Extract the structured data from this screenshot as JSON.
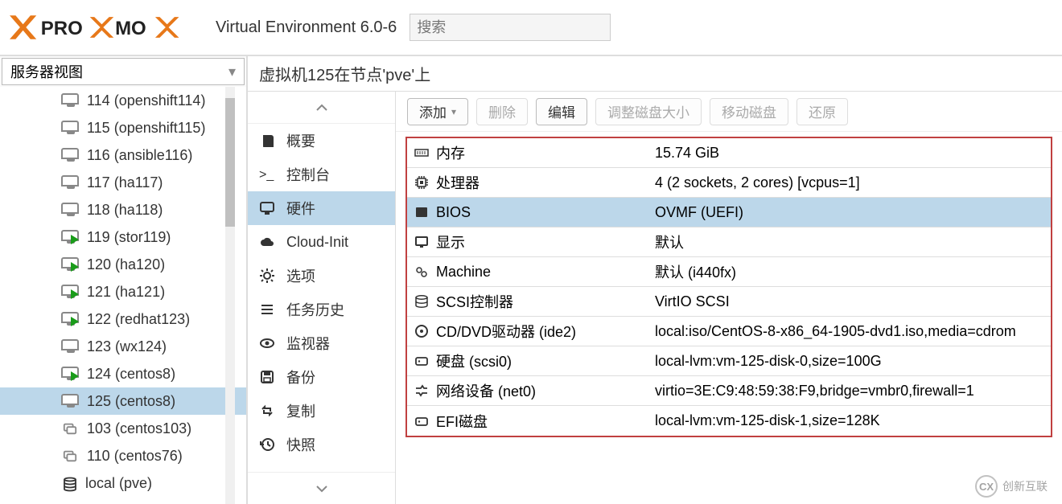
{
  "header": {
    "version_label": "Virtual Environment 6.0-6",
    "search_placeholder": "搜索"
  },
  "tree": {
    "view_label": "服务器视图",
    "items": [
      {
        "label": "114 (openshift114)",
        "type": "vm",
        "running": false
      },
      {
        "label": "115 (openshift115)",
        "type": "vm",
        "running": false
      },
      {
        "label": "116 (ansible116)",
        "type": "vm",
        "running": false
      },
      {
        "label": "117 (ha117)",
        "type": "vm",
        "running": false
      },
      {
        "label": "118 (ha118)",
        "type": "vm",
        "running": false
      },
      {
        "label": "119 (stor119)",
        "type": "vm",
        "running": true
      },
      {
        "label": "120 (ha120)",
        "type": "vm",
        "running": true
      },
      {
        "label": "121 (ha121)",
        "type": "vm",
        "running": true
      },
      {
        "label": "122 (redhat123)",
        "type": "vm",
        "running": true
      },
      {
        "label": "123 (wx124)",
        "type": "vm",
        "running": false
      },
      {
        "label": "124 (centos8)",
        "type": "vm",
        "running": true
      },
      {
        "label": "125 (centos8)",
        "type": "vm",
        "running": false,
        "selected": true
      },
      {
        "label": "103 (centos103)",
        "type": "lxc",
        "running": false
      },
      {
        "label": "110 (centos76)",
        "type": "lxc",
        "running": false
      },
      {
        "label": "local (pve)",
        "type": "storage",
        "running": false
      }
    ]
  },
  "content": {
    "title": "虚拟机125在节点'pve'上"
  },
  "midnav": {
    "items": [
      {
        "label": "概要",
        "icon": "book"
      },
      {
        "label": "控制台",
        "icon": "terminal"
      },
      {
        "label": "硬件",
        "icon": "monitor",
        "selected": true
      },
      {
        "label": "Cloud-Init",
        "icon": "cloud"
      },
      {
        "label": "选项",
        "icon": "gear"
      },
      {
        "label": "任务历史",
        "icon": "list"
      },
      {
        "label": "监视器",
        "icon": "eye"
      },
      {
        "label": "备份",
        "icon": "save"
      },
      {
        "label": "复制",
        "icon": "retweet"
      },
      {
        "label": "快照",
        "icon": "history"
      }
    ]
  },
  "toolbar": {
    "add": "添加",
    "remove": "删除",
    "edit": "编辑",
    "resize": "调整磁盘大小",
    "move": "移动磁盘",
    "revert": "还原"
  },
  "hardware": [
    {
      "icon": "memory",
      "key": "内存",
      "val": "15.74 GiB"
    },
    {
      "icon": "cpu",
      "key": "处理器",
      "val": "4 (2 sockets, 2 cores) [vcpus=1]"
    },
    {
      "icon": "bios",
      "key": "BIOS",
      "val": "OVMF (UEFI)",
      "selected": true
    },
    {
      "icon": "display",
      "key": "显示",
      "val": "默认"
    },
    {
      "icon": "gears",
      "key": "Machine",
      "val": "默认 (i440fx)"
    },
    {
      "icon": "stack",
      "key": "SCSI控制器",
      "val": "VirtIO SCSI"
    },
    {
      "icon": "disc",
      "key": "CD/DVD驱动器 (ide2)",
      "val": "local:iso/CentOS-8-x86_64-1905-dvd1.iso,media=cdrom"
    },
    {
      "icon": "hdd",
      "key": "硬盘 (scsi0)",
      "val": "local-lvm:vm-125-disk-0,size=100G"
    },
    {
      "icon": "net",
      "key": "网络设备 (net0)",
      "val": "virtio=3E:C9:48:59:38:F9,bridge=vmbr0,firewall=1"
    },
    {
      "icon": "hdd",
      "key": "EFI磁盘",
      "val": "local-lvm:vm-125-disk-1,size=128K"
    }
  ],
  "watermark": {
    "brand": "创新互联",
    "mark": "CX"
  }
}
